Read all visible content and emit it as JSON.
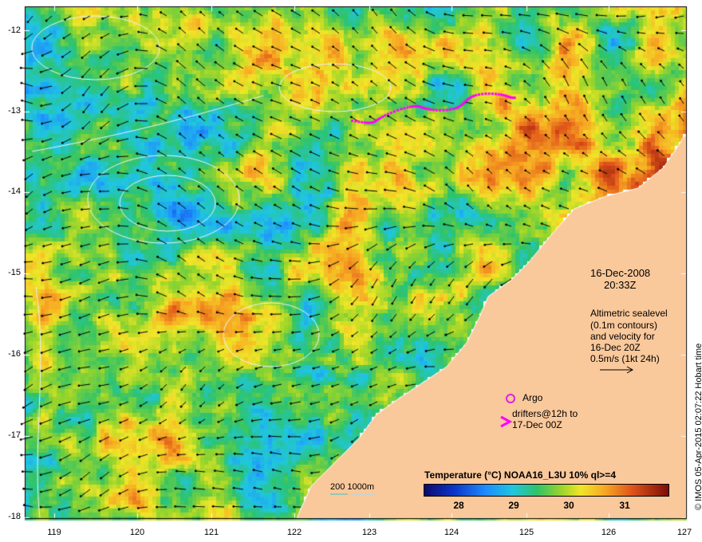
{
  "map": {
    "date": "16-Dec-2008",
    "time": "20:33Z",
    "altimetry_lines": [
      "Altimetric sealevel",
      "(0.1m contours)",
      "and velocity for",
      "16-Dec 20Z"
    ],
    "velocity_scale_label": "0.5m/s (1kt 24h)",
    "argo_label": "Argo",
    "drifters_lines": [
      "drifters@12h to",
      "17-Dec 00Z"
    ],
    "depth_label": "200  1000m",
    "credit": "© IMOS 05-Apr-2015 02:07:22 Hobart time",
    "colorbar": {
      "title": "Temperature (°C) NOAA16_L3U 10% ql>=4",
      "ticks": [
        "28",
        "29",
        "30",
        "31"
      ],
      "range": [
        27.5,
        31.8
      ]
    },
    "lat_ticks": [
      "-12",
      "-13",
      "-14",
      "-15",
      "-16",
      "-17",
      "-18"
    ],
    "lon_ticks": [
      "119",
      "120",
      "121",
      "122",
      "123",
      "124",
      "125",
      "126",
      "127"
    ],
    "colors": {
      "land": "#f9c89b",
      "coast": "#ffffff",
      "argo": "#e020e0",
      "drifter": "#ff00ff",
      "contour": "#e8f4ff",
      "arrow": "#000000"
    }
  }
}
